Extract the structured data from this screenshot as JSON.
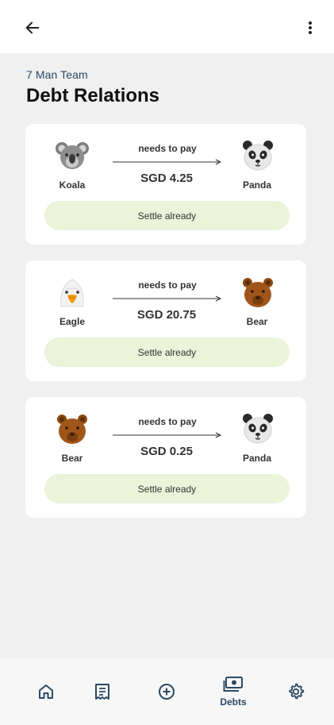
{
  "header": {
    "back_icon": "arrow-left-icon",
    "more_icon": "more-vertical-icon"
  },
  "group_name": "7 Man Team",
  "page_title": "Debt Relations",
  "debts": [
    {
      "from": "Koala",
      "from_icon": "koala-icon",
      "to": "Panda",
      "to_icon": "panda-icon",
      "relation": "needs to pay",
      "amount": "SGD 4.25",
      "action": "Settle already"
    },
    {
      "from": "Eagle",
      "from_icon": "eagle-icon",
      "to": "Bear",
      "to_icon": "bear-icon",
      "relation": "needs to pay",
      "amount": "SGD 20.75",
      "action": "Settle already"
    },
    {
      "from": "Bear",
      "from_icon": "bear-icon",
      "to": "Panda",
      "to_icon": "panda-icon",
      "relation": "needs to pay",
      "amount": "SGD 0.25",
      "action": "Settle already"
    }
  ],
  "bottom_nav": [
    {
      "icon": "home-icon",
      "label": ""
    },
    {
      "icon": "receipt-icon",
      "label": ""
    },
    {
      "icon": "add-circle-icon",
      "label": ""
    },
    {
      "icon": "money-icon",
      "label": "Debts",
      "active": true
    },
    {
      "icon": "settings-icon",
      "label": ""
    }
  ],
  "colors": {
    "accent": "#2c4a66",
    "settle_button": "#ebf3d8",
    "background": "#f0f0f0"
  }
}
